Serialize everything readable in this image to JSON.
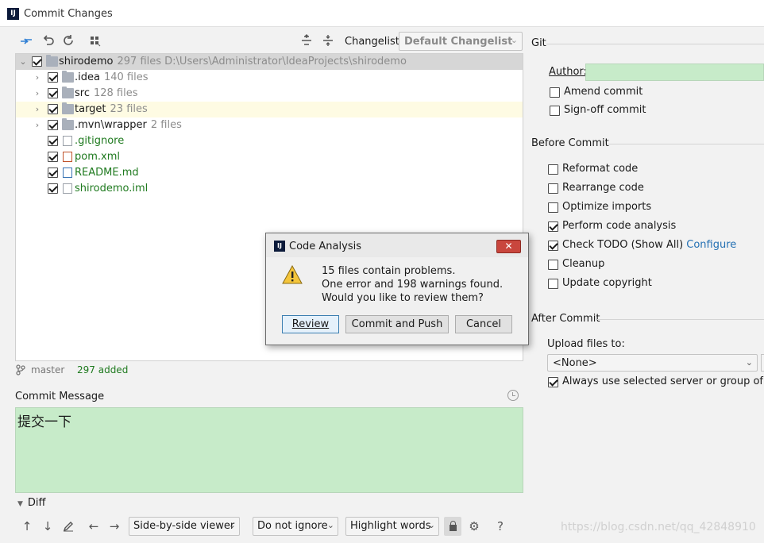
{
  "window": {
    "title": "Commit Changes",
    "logo_text": "IJ"
  },
  "toolbar": {
    "icons": [
      "diff-arrows-icon",
      "rollback-icon",
      "refresh-icon",
      "group-by-icon",
      "expand-all-icon",
      "collapse-all-icon"
    ]
  },
  "changelist": {
    "label": "Changelist:",
    "value": "Default Changelist"
  },
  "tree": {
    "rows": [
      {
        "name": "shirodemo",
        "meta": "297 files  D:\\Users\\Administrator\\IdeaProjects\\shirodemo",
        "icon": "folder-icon",
        "expanded": true,
        "level": 0,
        "color": "default"
      },
      {
        "name": ".idea",
        "meta": "140 files",
        "icon": "folder-icon",
        "level": 1,
        "color": "default"
      },
      {
        "name": "src",
        "meta": "128 files",
        "icon": "folder-icon",
        "level": 1,
        "color": "default"
      },
      {
        "name": "target",
        "meta": "23 files",
        "icon": "folder-icon",
        "level": 1,
        "color": "default"
      },
      {
        "name": ".mvn\\wrapper",
        "meta": "2 files",
        "icon": "folder-icon",
        "level": 1,
        "color": "default"
      },
      {
        "name": ".gitignore",
        "meta": "",
        "icon": "gitignore-file-icon",
        "level": 1,
        "color": "green"
      },
      {
        "name": "pom.xml",
        "meta": "",
        "icon": "maven-file-icon",
        "level": 1,
        "color": "green"
      },
      {
        "name": "README.md",
        "meta": "",
        "icon": "markdown-file-icon",
        "level": 1,
        "color": "green"
      },
      {
        "name": "shirodemo.iml",
        "meta": "",
        "icon": "iml-file-icon",
        "level": 1,
        "color": "green"
      }
    ]
  },
  "status": {
    "branch": "master",
    "added": "297 added"
  },
  "commit_message": {
    "label": "Commit Message",
    "text": "提交一下"
  },
  "diff": {
    "label": "Diff",
    "viewer": "Side-by-side viewer",
    "ignore": "Do not ignore",
    "highlight": "Highlight words"
  },
  "git": {
    "section": "Git",
    "author_label": "Author:",
    "author_value": "",
    "amend": "Amend commit",
    "signoff": "Sign-off commit"
  },
  "before_commit": {
    "section": "Before Commit",
    "reformat": "Reformat code",
    "rearrange": "Rearrange code",
    "optimize": "Optimize imports",
    "analysis": "Perform code analysis",
    "todo": "Check TODO (Show All)",
    "todo_link": "Configure",
    "cleanup": "Cleanup",
    "copyright": "Update copyright"
  },
  "after_commit": {
    "section": "After Commit",
    "upload_label": "Upload files to:",
    "upload_value": "<None>",
    "always_use": "Always use selected server or group of serv"
  },
  "dialog": {
    "title": "Code Analysis",
    "logo_text": "IJ",
    "line1": "15 files contain problems.",
    "line2": "One error and 198 warnings found.",
    "line3": "Would you like to review them?",
    "review": "Review",
    "commit_push": "Commit and Push",
    "cancel": "Cancel"
  },
  "watermark": "https://blog.csdn.net/qq_42848910"
}
